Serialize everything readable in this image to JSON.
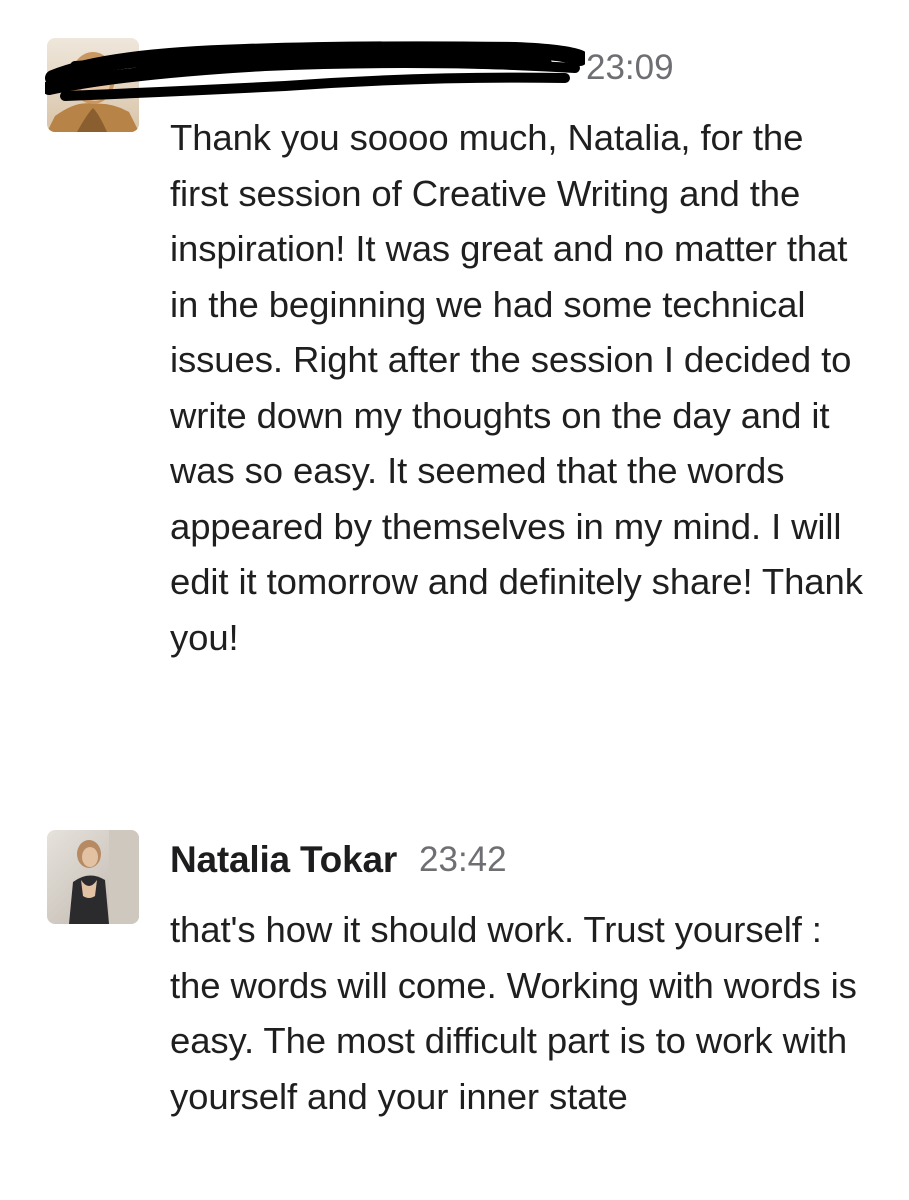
{
  "messages": [
    {
      "author": "",
      "author_redacted": true,
      "time": "23:09",
      "avatar": "avatar-woman-blonde",
      "text": "Thank you soooo much, Natalia, for the first session of Creative Writing and the inspiration! It was great and no matter that in the beginning we had some technical issues. Right after the session I decided to write down my thoughts on the day and it was so easy. It seemed that the words appeared by themselves in my mind. I will edit it tomorrow and definitely share! Thank you!"
    },
    {
      "author": "Natalia Tokar",
      "author_redacted": false,
      "time": "23:42",
      "avatar": "avatar-woman-dark-outfit",
      "text": "that's how it should work. Trust yourself : the words will come. Working with words is easy. The most difficult part is to work with yourself and your inner state"
    }
  ],
  "colors": {
    "text": "#1f1f1f",
    "time": "#6e6e73",
    "background": "#ffffff",
    "redaction": "#000000"
  }
}
